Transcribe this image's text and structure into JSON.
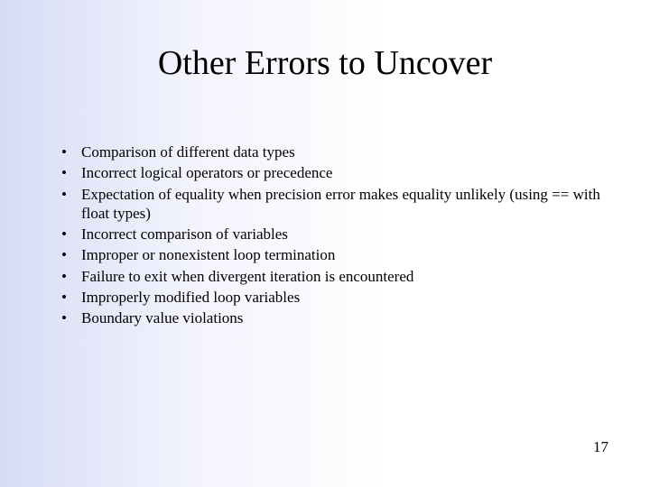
{
  "slide": {
    "title": "Other Errors to Uncover",
    "bullets": [
      "Comparison of different data types",
      "Incorrect logical operators or precedence",
      "Expectation of equality when precision error makes equality unlikely (using == with float types)",
      "Incorrect comparison of variables",
      "Improper or nonexistent loop termination",
      "Failure to exit when divergent iteration is encountered",
      "Improperly modified loop variables",
      "Boundary value violations"
    ],
    "pageNumber": "17"
  }
}
